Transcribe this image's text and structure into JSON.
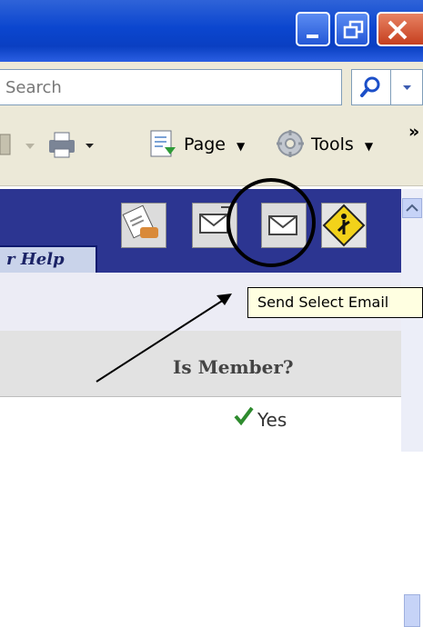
{
  "browser": {
    "window_controls": {
      "minimize_icon": "minimize-icon",
      "restore_icon": "restore-icon",
      "close_icon": "close-icon"
    },
    "search": {
      "placeholder": "Search"
    },
    "commands": {
      "page_label": "Page",
      "tools_label": "Tools",
      "more_label": "»"
    }
  },
  "app": {
    "help_label": "r Help",
    "toolbar_icons": [
      "edit-record-icon",
      "send-email-icon",
      "send-select-email-icon",
      "caution-sign-icon"
    ],
    "tooltip": "Send Select Email"
  },
  "table": {
    "column_header": "Is Member?",
    "cell_value": "Yes"
  },
  "colors": {
    "titlebar": "#0b46cf",
    "app_toolbar": "#2c3591",
    "tooltip_bg": "#ffffe1",
    "check_green": "#2e8b2e"
  }
}
